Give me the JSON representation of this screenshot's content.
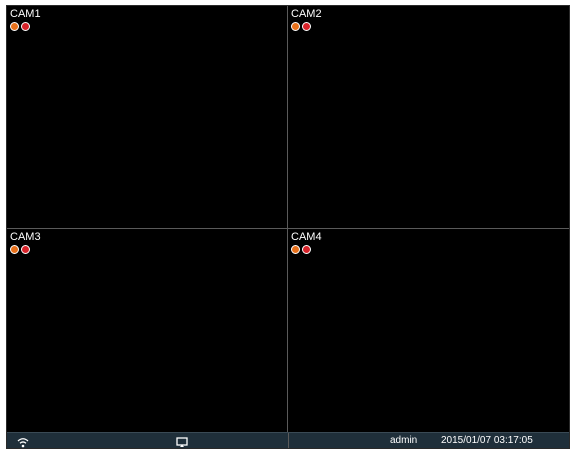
{
  "cameras": [
    {
      "label": "CAM1"
    },
    {
      "label": "CAM2"
    },
    {
      "label": "CAM3"
    },
    {
      "label": "CAM4"
    }
  ],
  "status_icons": [
    "motion-indicator-icon",
    "record-indicator-icon"
  ],
  "colors": {
    "motion_indicator": "#e8701a",
    "record_indicator": "#d8232a",
    "statusbar_bg": "#1f2f3a",
    "video_bg": "#000000"
  },
  "statusbar": {
    "network_icon": "wifi-icon",
    "display_icon": "screen-cast-icon",
    "user": "admin",
    "datetime": "2015/01/07  03:17:05"
  }
}
